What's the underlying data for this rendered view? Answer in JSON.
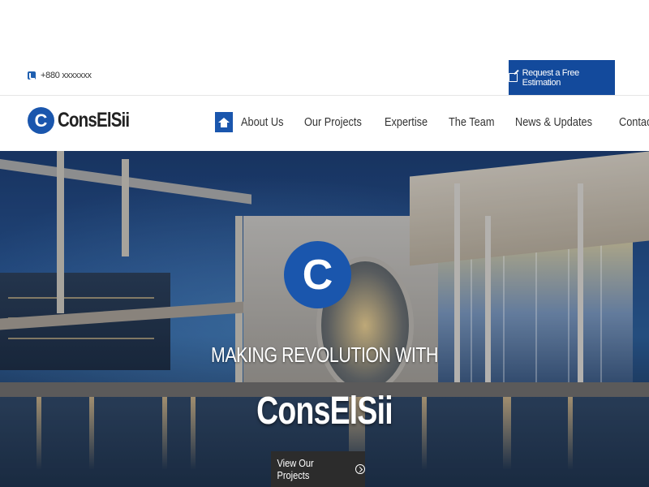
{
  "topbar": {
    "phone": "+880 xxxxxxx",
    "estimate_label": "Request a Free Estimation"
  },
  "header": {
    "logo_mark": "C",
    "logo_text": "ConsElSii",
    "nav": [
      {
        "label": "About Us"
      },
      {
        "label": "Our Projects"
      },
      {
        "label": "Expertise"
      },
      {
        "label": "The Team"
      },
      {
        "label": "News & Updates"
      },
      {
        "label": "Contact"
      }
    ]
  },
  "hero": {
    "logo_mark": "C",
    "tagline": "MAKING REVOLUTION WITH",
    "title": "ConsElSii",
    "cta_label": "View Our Projects"
  },
  "colors": {
    "brand_blue": "#1a56ad",
    "button_dark_blue": "#134a9c",
    "cta_dark": "#2c2c2c"
  },
  "icons": [
    "phone-icon",
    "edit-icon",
    "home-icon",
    "arrow-circle-right-icon"
  ]
}
